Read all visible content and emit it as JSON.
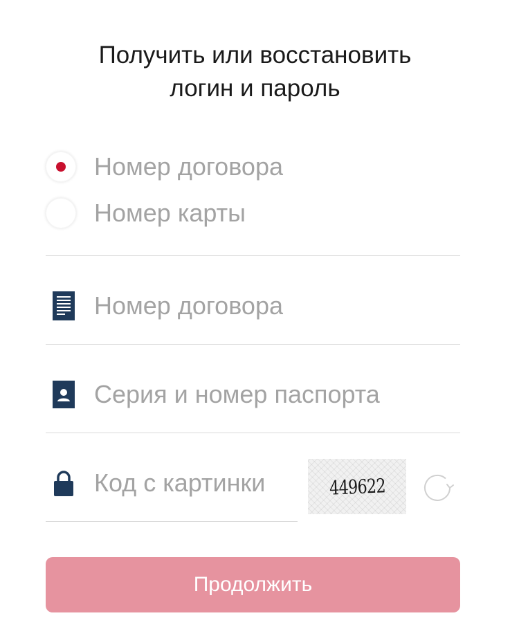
{
  "header": {
    "title_line1": "Получить или восстановить",
    "title_line2": "логин и пароль"
  },
  "id_type": {
    "options": [
      {
        "label": "Номер договора",
        "selected": true
      },
      {
        "label": "Номер карты",
        "selected": false
      }
    ]
  },
  "fields": {
    "contract_number": {
      "value": "",
      "placeholder": "Номер договора",
      "icon": "document-icon"
    },
    "passport": {
      "value": "",
      "placeholder": "Серия и номер паспорта",
      "icon": "person-card-icon"
    },
    "captcha_code": {
      "value": "",
      "placeholder": "Код с картинки",
      "icon": "lock-icon"
    }
  },
  "captcha": {
    "image_text": "449622",
    "refresh_icon": "refresh-icon"
  },
  "actions": {
    "submit_label": "Продолжить"
  },
  "colors": {
    "accent": "#c8102e",
    "button_bg": "#e6939f",
    "icon": "#1f3a5a",
    "placeholder": "#a3a3a3",
    "divider": "#d9d9d9"
  }
}
